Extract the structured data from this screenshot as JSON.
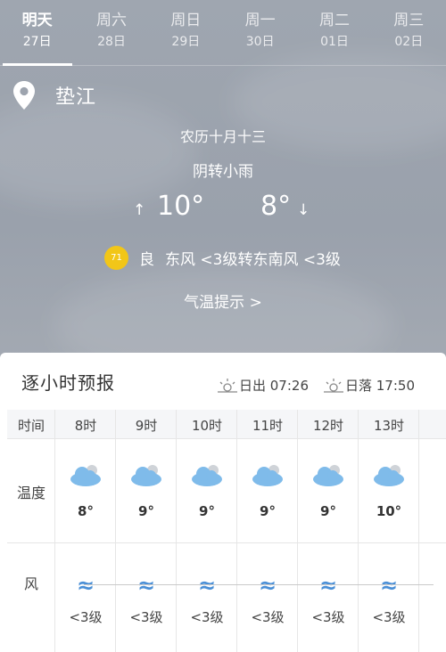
{
  "tabs": [
    {
      "weekday": "明天",
      "date": "27日",
      "active": true
    },
    {
      "weekday": "周六",
      "date": "28日"
    },
    {
      "weekday": "周日",
      "date": "29日"
    },
    {
      "weekday": "周一",
      "date": "30日"
    },
    {
      "weekday": "周二",
      "date": "01日"
    },
    {
      "weekday": "周三",
      "date": "02日"
    }
  ],
  "location": {
    "city": "垫江",
    "icon": "location-pin-icon"
  },
  "lunar": "农历十月十三",
  "condition": "阴转小雨",
  "temps": {
    "high": "10°",
    "low": "8°",
    "up_arrow": "↑",
    "down_arrow": "↓"
  },
  "air": {
    "aqi": "71",
    "level": "良",
    "wind": "东风 <3级转东南风 <3级",
    "badge_color": "#f2c618"
  },
  "tip": "气温提示 >",
  "hourly": {
    "title": "逐小时预报",
    "sunrise": "日出 07:26",
    "sunset": "日落 17:50",
    "row_labels": {
      "time": "时间",
      "temp": "温度",
      "wind": "风"
    },
    "hours": [
      {
        "time": "8时",
        "temp": "8°",
        "wind": "<3级",
        "icon": "cloudy-icon",
        "wind_icon": "≈"
      },
      {
        "time": "9时",
        "temp": "9°",
        "wind": "<3级",
        "icon": "cloudy-icon",
        "wind_icon": "≈"
      },
      {
        "time": "10时",
        "temp": "9°",
        "wind": "<3级",
        "icon": "cloudy-icon",
        "wind_icon": "≈"
      },
      {
        "time": "11时",
        "temp": "9°",
        "wind": "<3级",
        "icon": "cloudy-icon",
        "wind_icon": "≈"
      },
      {
        "time": "12时",
        "temp": "9°",
        "wind": "<3级",
        "icon": "cloudy-icon",
        "wind_icon": "≈"
      },
      {
        "time": "13时",
        "temp": "10°",
        "wind": "<3级",
        "icon": "cloudy-icon",
        "wind_icon": "≈"
      }
    ]
  }
}
